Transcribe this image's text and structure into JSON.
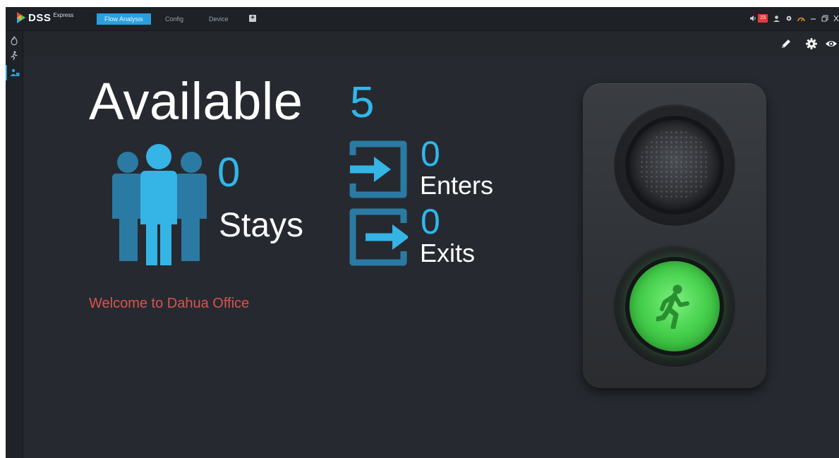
{
  "app": {
    "brand": "DSS",
    "brand_sub": "Express"
  },
  "tabs": [
    {
      "label": "Flow Analysis",
      "active": true
    },
    {
      "label": "Config",
      "active": false
    },
    {
      "label": "Device",
      "active": false
    }
  ],
  "tab_add_label": "+",
  "topbar_right": {
    "alarm_count": "23",
    "icons": [
      "speaker-icon",
      "user-icon",
      "gear-icon",
      "gauge-icon",
      "minimize-icon",
      "restore-icon",
      "close-icon"
    ]
  },
  "sidebar": {
    "items": [
      {
        "icon": "flame-icon"
      },
      {
        "icon": "running-person-icon"
      },
      {
        "icon": "people-count-icon",
        "active": true
      }
    ]
  },
  "toolbar": {
    "icons": [
      "pencil-icon",
      "settings-icon",
      "eye-icon"
    ]
  },
  "dashboard": {
    "available_label": "Available",
    "available_value": "5",
    "stays_value": "0",
    "stays_label": "Stays",
    "enters_value": "0",
    "enters_label": "Enters",
    "exits_value": "0",
    "exits_label": "Exits",
    "welcome_message": "Welcome to Dahua Office"
  },
  "traffic_light": {
    "red_lamp": "off",
    "green_lamp": "on",
    "signal_icon": "walking-person-icon"
  },
  "colors": {
    "accent_blue": "#2fb7ec",
    "tab_active": "#2a9fdd",
    "welcome_red": "#d9534f",
    "green_light": "#48d24e",
    "background": "#262a30"
  }
}
